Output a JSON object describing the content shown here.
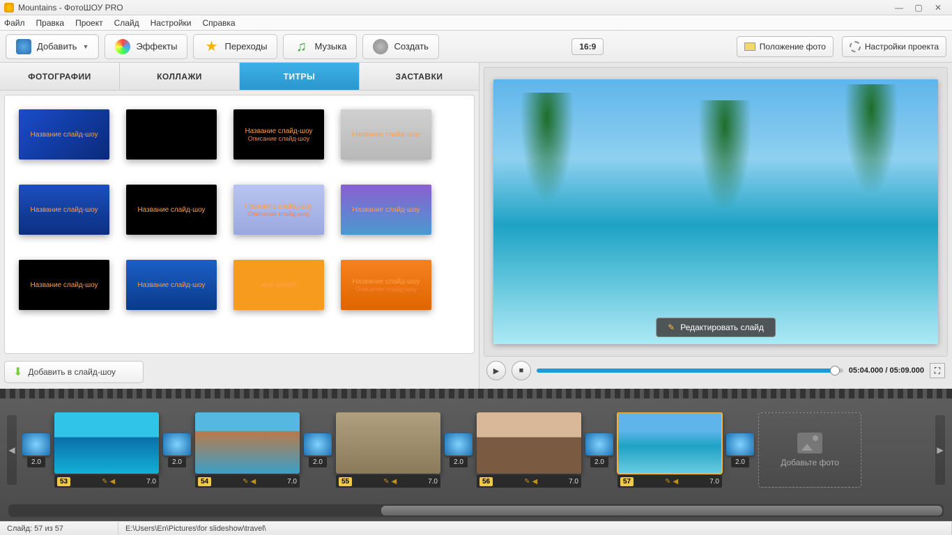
{
  "window": {
    "title": "Mountains - ФотоШОУ PRO"
  },
  "menu": {
    "file": "Файл",
    "edit": "Правка",
    "project": "Проект",
    "slide": "Слайд",
    "settings": "Настройки",
    "help": "Справка"
  },
  "toolbar": {
    "add": "Добавить",
    "effects": "Эффекты",
    "transitions": "Переходы",
    "music": "Музыка",
    "create": "Создать",
    "aspect": "16:9",
    "photo_position": "Положение фото",
    "project_settings": "Настройки проекта"
  },
  "left_tabs": {
    "photos": "ФОТОГРАФИИ",
    "collages": "КОЛЛАЖИ",
    "titles": "ТИТРЫ",
    "intros": "ЗАСТАВКИ"
  },
  "templates": [
    {
      "l1": "Название слайд-шоу",
      "l2": "",
      "cls": "blue-grad"
    },
    {
      "l1": "",
      "l2": "",
      "cls": "black"
    },
    {
      "l1": "Название слайд-шоу",
      "l2": "Описание слайд-шоу",
      "cls": "black"
    },
    {
      "l1": "Название слайд-шоу",
      "l2": "",
      "cls": "gray"
    },
    {
      "l1": "Название слайд-шоу",
      "l2": "",
      "cls": "dblue"
    },
    {
      "l1": "Название слайд-шоу",
      "l2": "",
      "cls": "black"
    },
    {
      "l1": "Название слайд-шоу",
      "l2": "Описание слайд-шоу",
      "cls": "lavender"
    },
    {
      "l1": "Название слайд-шоу",
      "l2": "",
      "cls": "purple-grad"
    },
    {
      "l1": "Название слайд-шоу",
      "l2": "",
      "cls": "black"
    },
    {
      "l1": "Название слайд-шоу",
      "l2": "",
      "cls": "blue-sky"
    },
    {
      "l1": "ние слайд",
      "l2": "",
      "cls": "orange-h"
    },
    {
      "l1": "Название слайд-шоу",
      "l2": "Описание слайд-шоу",
      "cls": "orange"
    }
  ],
  "add_to_slideshow": "Добавить в слайд-шоу",
  "preview": {
    "edit_slide": "Редактировать слайд",
    "time": "05:04.000 / 05:09.000"
  },
  "timeline": {
    "transition_dur": "2.0",
    "slides": [
      {
        "num": "53",
        "dur": "7.0",
        "cls": "beach"
      },
      {
        "num": "54",
        "dur": "7.0",
        "cls": "reef"
      },
      {
        "num": "55",
        "dur": "7.0",
        "cls": "statue"
      },
      {
        "num": "56",
        "dur": "7.0",
        "cls": "cat"
      },
      {
        "num": "57",
        "dur": "7.0",
        "cls": "palms",
        "selected": true
      }
    ],
    "add_photo": "Добавьте фото"
  },
  "status": {
    "slide_count": "Слайд: 57 из 57",
    "path": "E:\\Users\\En\\Pictures\\for slideshow\\travel\\"
  }
}
